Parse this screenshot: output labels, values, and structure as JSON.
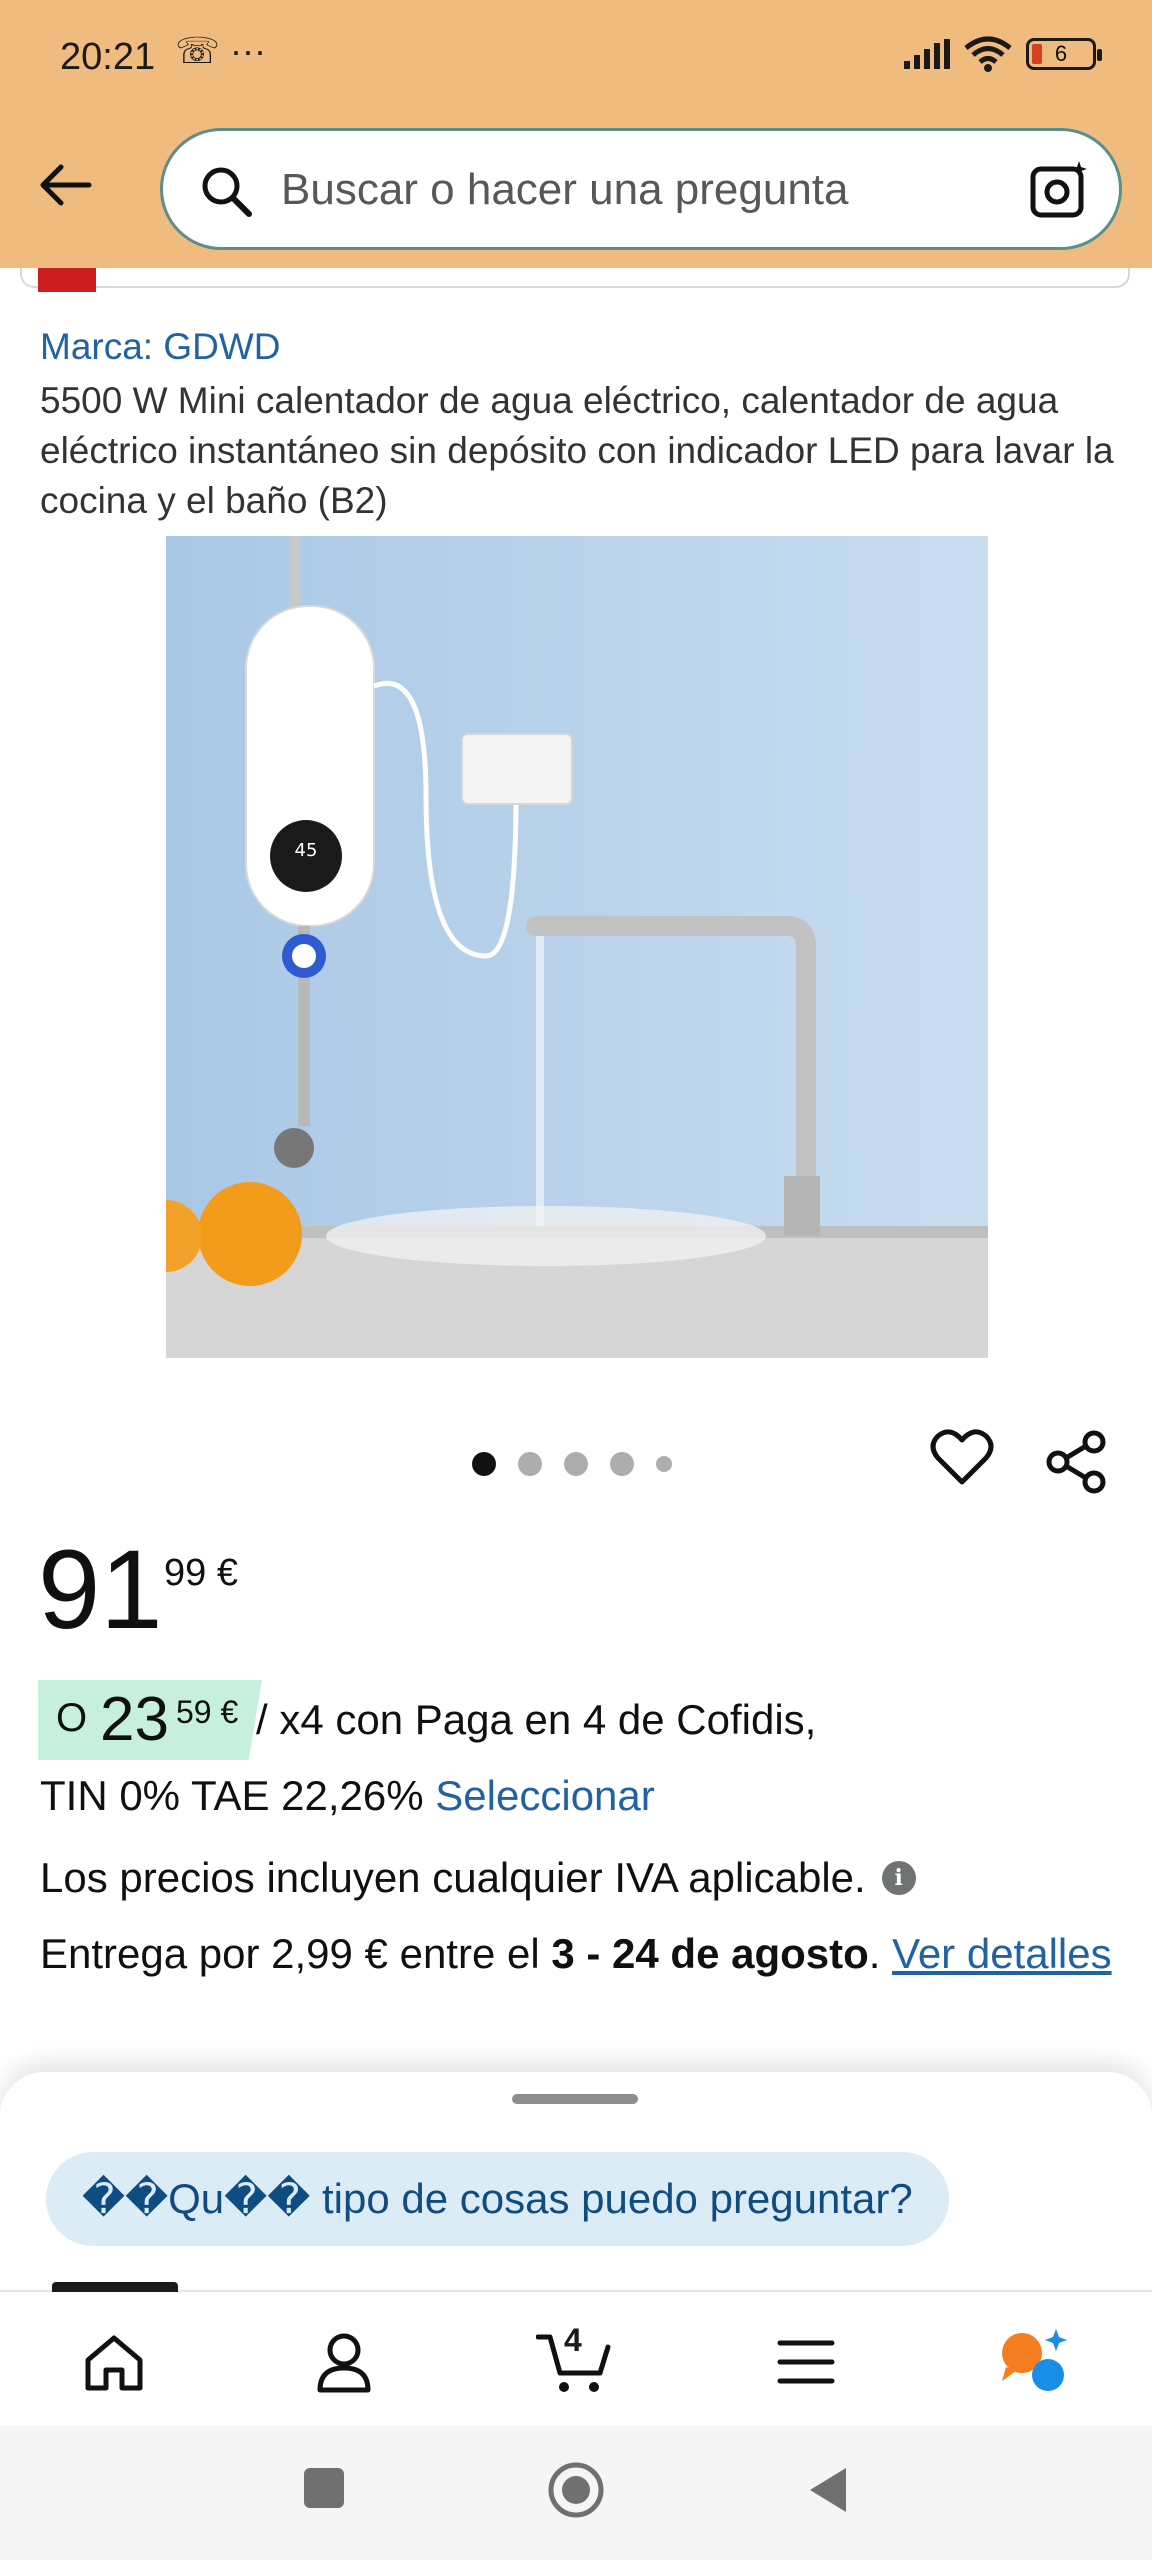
{
  "status_bar": {
    "time": "20:21",
    "left_icons": "☏ ···",
    "battery": "6"
  },
  "search": {
    "placeholder": "Buscar o hacer una pregunta"
  },
  "product": {
    "brand": "Marca: GDWD",
    "title": "5500 W Mini calentador de agua eléctrico, calentador de agua eléctrico instantáneo sin depósito con indicador LED para lavar la cocina y el baño (B2)",
    "image_display": "45",
    "image_count": 5,
    "active_image_index": 0
  },
  "price": {
    "whole": "91",
    "fraction": "99 €"
  },
  "installments": {
    "prefix": "O",
    "whole": "23",
    "fraction": "59 €",
    "text": "/ x4 con Paga en 4 de Cofidis,",
    "terms": "TIN 0% TAE 22,26%",
    "select_label": "Seleccionar"
  },
  "vat_note": "Los precios incluyen cualquier IVA aplicable.",
  "delivery": {
    "prefix": "Entrega por 2,99 € entre el",
    "dates": "3 - 24 de agosto",
    "suffix": ".",
    "details_link": "Ver detalles"
  },
  "assistant": {
    "suggestion": "��Qu�� tipo de cosas puedo preguntar?"
  },
  "bottom_nav": {
    "items": [
      "home-icon",
      "account-icon",
      "cart-icon",
      "menu-icon",
      "rufus-icon"
    ],
    "cart_count": "4",
    "active_index": 0
  },
  "colors": {
    "header_bg": "#f0bb7e",
    "link": "#2162a1",
    "installment_badge": "#c6f0dd",
    "chip_bg": "#dcecf7"
  }
}
